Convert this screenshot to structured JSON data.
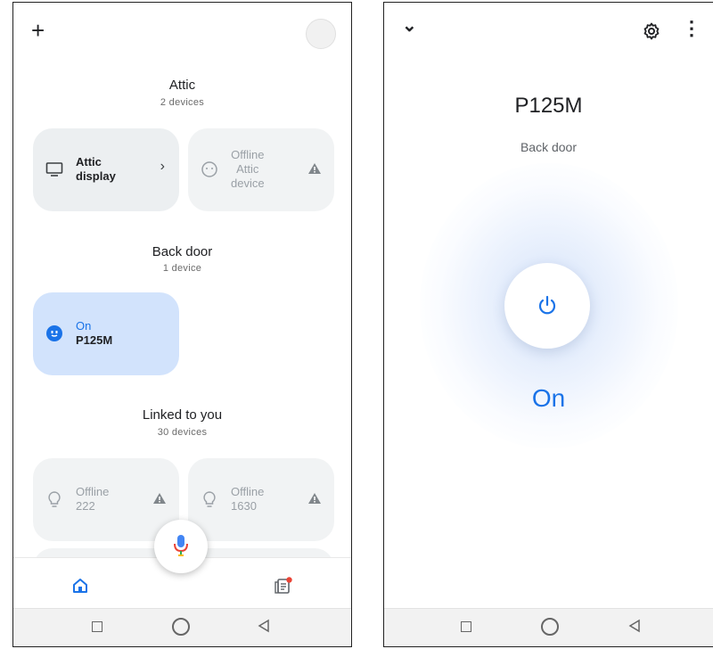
{
  "left": {
    "rooms": [
      {
        "title": "Attic",
        "subtitle": "2 devices"
      },
      {
        "title": "Back door",
        "subtitle": "1 device"
      },
      {
        "title": "Linked to you",
        "subtitle": "30 devices"
      }
    ],
    "cards": {
      "attic_display": {
        "line1": "Attic",
        "line2": "display",
        "icon": "tv-icon"
      },
      "attic_device": {
        "line1": "Offline",
        "line2": "Attic",
        "line3": "device",
        "icon": "speaker-icon"
      },
      "p125m": {
        "line1": "On",
        "line2": "P125M",
        "icon": "plug-icon"
      },
      "device_222": {
        "line1": "Offline",
        "line2": "222",
        "icon": "bulb-icon"
      },
      "device_1630": {
        "line1": "Offline",
        "line2": "1630",
        "icon": "bulb-icon"
      }
    },
    "add_icon": "+",
    "colors": {
      "accent": "#1a73e8",
      "on_card": "#d2e3fc",
      "notify": "#ea4335"
    }
  },
  "right": {
    "device_name": "P125M",
    "room": "Back door",
    "state": "On",
    "collapse_icon": "⌄",
    "more_icon": "⋮",
    "colors": {
      "state_text": "#1a73e8"
    }
  }
}
